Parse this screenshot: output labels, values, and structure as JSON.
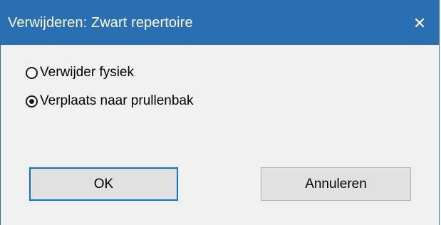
{
  "dialog": {
    "title": "Verwijderen: Zwart repertoire",
    "close_icon": "close-icon",
    "options": [
      {
        "label": "Verwijder fysiek",
        "selected": false
      },
      {
        "label": "Verplaats naar prullenbak",
        "selected": true
      }
    ],
    "ok_label": "OK",
    "cancel_label": "Annuleren"
  },
  "colors": {
    "titlebar": "#2b6fb3",
    "dialog_bg": "#f0f0f0",
    "button_bg": "#e1e1e1",
    "focus_border": "#0078d7"
  }
}
